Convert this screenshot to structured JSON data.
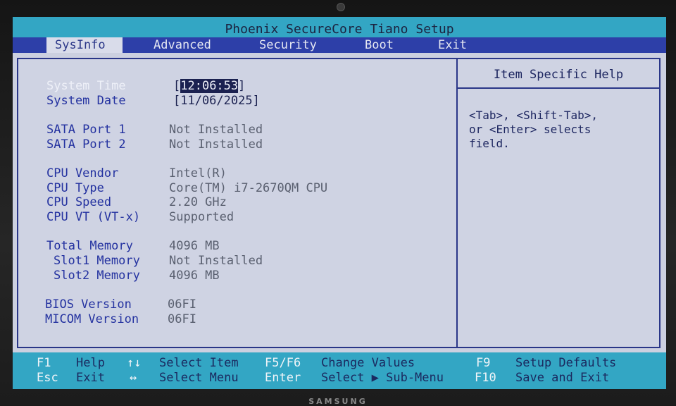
{
  "header": {
    "title": "Phoenix SecureCore Tiano Setup"
  },
  "menu": {
    "tabs": [
      {
        "label": "SysInfo"
      },
      {
        "label": "Advanced"
      },
      {
        "label": "Security"
      },
      {
        "label": "Boot"
      },
      {
        "label": "Exit"
      }
    ],
    "active_tab": "SysInfo"
  },
  "sysinfo": {
    "system_time": {
      "label": "System Time",
      "open": "[",
      "value": "12:06:53",
      "close": "]"
    },
    "system_date": {
      "label": "System Date",
      "value": "[11/06/2025]"
    },
    "sata_port_1": {
      "label": "SATA Port 1",
      "value": "Not Installed"
    },
    "sata_port_2": {
      "label": "SATA Port 2",
      "value": "Not Installed"
    },
    "cpu_vendor": {
      "label": "CPU Vendor",
      "value": "Intel(R)"
    },
    "cpu_type": {
      "label": "CPU Type",
      "value": "Core(TM) i7-2670QM CPU"
    },
    "cpu_speed": {
      "label": "CPU Speed",
      "value": "2.20 GHz"
    },
    "cpu_vt": {
      "label": "CPU VT (VT-x)",
      "value": "Supported"
    },
    "total_memory": {
      "label": "Total Memory",
      "value": "4096 MB"
    },
    "slot1_memory": {
      "label": "Slot1 Memory",
      "value": "Not Installed"
    },
    "slot2_memory": {
      "label": "Slot2 Memory",
      "value": "4096 MB"
    },
    "bios_version": {
      "label": "BIOS Version",
      "value": "06FI"
    },
    "micom_version": {
      "label": "MICOM Version",
      "value": "06FI"
    }
  },
  "help": {
    "title": "Item Specific Help",
    "text": "<Tab>, <Shift-Tab>,\nor <Enter> selects\nfield."
  },
  "footer": {
    "row1": [
      {
        "key": "F1",
        "desc": "Help"
      },
      {
        "key": "↑↓",
        "desc": "Select Item"
      },
      {
        "key": "F5/F6",
        "desc": "Change Values"
      },
      {
        "key": "F9",
        "desc": "Setup Defaults"
      }
    ],
    "row2": [
      {
        "key": "Esc",
        "desc": "Exit"
      },
      {
        "key": "↔",
        "desc": "Select Menu"
      },
      {
        "key": "Enter",
        "desc": "Select ▶ Sub-Menu"
      },
      {
        "key": "F10",
        "desc": "Save and Exit"
      }
    ]
  },
  "bezel": {
    "brand": "SAMSUNG"
  },
  "colors": {
    "title_bar": "#33a6c4",
    "menu_bar": "#2d3fa8",
    "panel_bg": "#cfd3e3",
    "label_blue": "#2432a0",
    "value_gray": "#5a6070"
  }
}
